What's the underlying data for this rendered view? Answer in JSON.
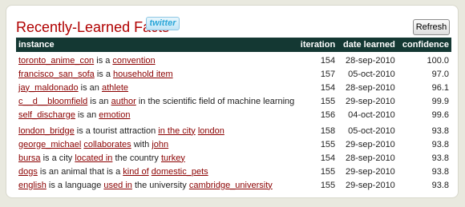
{
  "header": {
    "title": "Recently-Learned Facts",
    "twitter_label": "twitter",
    "refresh_label": "Refresh"
  },
  "table": {
    "columns": [
      "instance",
      "iteration",
      "date learned",
      "confidence"
    ],
    "rows": [
      {
        "parts": [
          {
            "text": "toronto_anime_con",
            "link": true
          },
          {
            "text": " is a ",
            "link": false
          },
          {
            "text": "convention",
            "link": true
          }
        ],
        "iteration": "154",
        "date": "28-sep-2010",
        "confidence": "100.0"
      },
      {
        "parts": [
          {
            "text": "francisco_san_sofa",
            "link": true
          },
          {
            "text": " is a ",
            "link": false
          },
          {
            "text": "household item",
            "link": true
          }
        ],
        "iteration": "157",
        "date": "05-oct-2010",
        "confidence": "97.0"
      },
      {
        "parts": [
          {
            "text": "jay_maldonado",
            "link": true
          },
          {
            "text": " is an ",
            "link": false
          },
          {
            "text": "athlete",
            "link": true
          }
        ],
        "iteration": "154",
        "date": "28-sep-2010",
        "confidence": "96.1"
      },
      {
        "parts": [
          {
            "text": "c__d__bloomfield",
            "link": true
          },
          {
            "text": " is an ",
            "link": false
          },
          {
            "text": "author",
            "link": true
          },
          {
            "text": " in the scientific field of machine learning",
            "link": false
          }
        ],
        "iteration": "155",
        "date": "29-sep-2010",
        "confidence": "99.9"
      },
      {
        "parts": [
          {
            "text": "self_discharge",
            "link": true
          },
          {
            "text": " is an ",
            "link": false
          },
          {
            "text": "emotion",
            "link": true
          }
        ],
        "iteration": "156",
        "date": "04-oct-2010",
        "confidence": "99.6"
      },
      {
        "parts": [
          {
            "text": "london_bridge",
            "link": true
          },
          {
            "text": " is a tourist attraction ",
            "link": false
          },
          {
            "text": "in the city",
            "link": true
          },
          {
            "text": " ",
            "link": false
          },
          {
            "text": "london",
            "link": true
          }
        ],
        "iteration": "158",
        "date": "05-oct-2010",
        "confidence": "93.8"
      },
      {
        "parts": [
          {
            "text": "george_michael",
            "link": true
          },
          {
            "text": " ",
            "link": false
          },
          {
            "text": "collaborates",
            "link": true
          },
          {
            "text": " with ",
            "link": false
          },
          {
            "text": "john",
            "link": true
          }
        ],
        "iteration": "155",
        "date": "29-sep-2010",
        "confidence": "93.8"
      },
      {
        "parts": [
          {
            "text": "bursa",
            "link": true
          },
          {
            "text": " is a city ",
            "link": false
          },
          {
            "text": "located in",
            "link": true
          },
          {
            "text": " the country ",
            "link": false
          },
          {
            "text": "turkey",
            "link": true
          }
        ],
        "iteration": "154",
        "date": "28-sep-2010",
        "confidence": "93.8"
      },
      {
        "parts": [
          {
            "text": "dogs",
            "link": true
          },
          {
            "text": " is an animal that is a ",
            "link": false
          },
          {
            "text": "kind of",
            "link": true
          },
          {
            "text": " ",
            "link": false
          },
          {
            "text": "domestic_pets",
            "link": true
          }
        ],
        "iteration": "155",
        "date": "29-sep-2010",
        "confidence": "93.8"
      },
      {
        "parts": [
          {
            "text": "english",
            "link": true
          },
          {
            "text": " is a language ",
            "link": false
          },
          {
            "text": "used in",
            "link": true
          },
          {
            "text": " the university ",
            "link": false
          },
          {
            "text": "cambridge_university",
            "link": true
          }
        ],
        "iteration": "155",
        "date": "29-sep-2010",
        "confidence": "93.8"
      }
    ]
  },
  "colors": {
    "title": "#b00000",
    "link": "#8b0000",
    "header_bg": "#143833",
    "page_bg": "#e9e9df"
  }
}
